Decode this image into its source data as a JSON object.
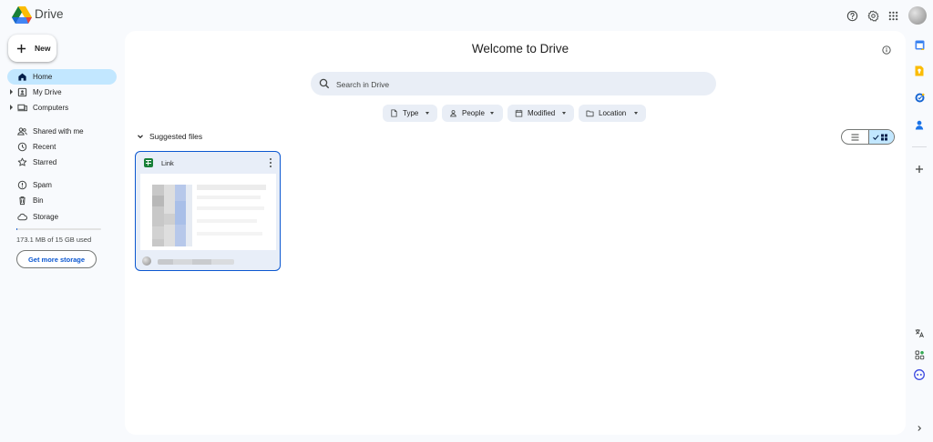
{
  "app": {
    "brand": "Drive"
  },
  "sidebar": {
    "new_label": "New",
    "items": [
      {
        "label": "Home",
        "icon": "home-icon",
        "active": true
      },
      {
        "label": "My Drive",
        "icon": "my-drive-icon",
        "expandable": true
      },
      {
        "label": "Computers",
        "icon": "computers-icon",
        "expandable": true
      },
      {
        "label": "Shared with me",
        "icon": "people-icon"
      },
      {
        "label": "Recent",
        "icon": "clock-icon"
      },
      {
        "label": "Starred",
        "icon": "star-icon"
      },
      {
        "label": "Spam",
        "icon": "spam-icon"
      },
      {
        "label": "Bin",
        "icon": "trash-icon"
      },
      {
        "label": "Storage",
        "icon": "cloud-icon"
      }
    ],
    "storage_text": "173.1 MB of 15 GB used",
    "storage_fraction": 0.011,
    "get_storage_label": "Get more storage"
  },
  "main": {
    "title": "Welcome to Drive",
    "search_placeholder": "Search in Drive",
    "filters": [
      {
        "label": "Type",
        "icon": "file-icon"
      },
      {
        "label": "People",
        "icon": "person-icon"
      },
      {
        "label": "Modified",
        "icon": "calendar-icon"
      },
      {
        "label": "Location",
        "icon": "folder-icon"
      }
    ],
    "section_title": "Suggested files",
    "view_mode": "grid",
    "files": [
      {
        "name": "Link",
        "type": "sheets-icon"
      }
    ]
  },
  "colors": {
    "accent": "#0b57d0",
    "active_nav": "#c2e7ff",
    "panel_bg": "#ffffff",
    "page_bg": "#f8fafd",
    "chip_bg": "#e9eef6"
  }
}
